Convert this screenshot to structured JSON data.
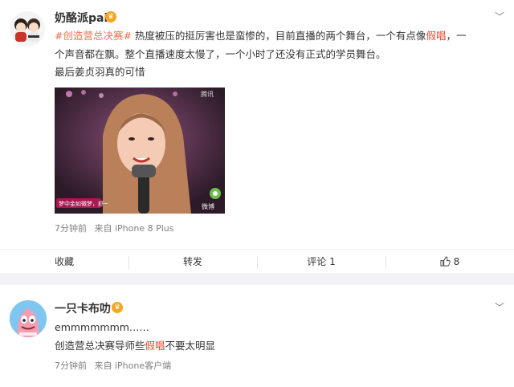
{
  "post": {
    "username": "奶酪派pai",
    "topic": "#创造营总决赛#",
    "line1_rest": " 热度被压的挺厉害也是蛮惨的，目前直播的两个舞台，一个有点像",
    "line1_highlight": "假唱",
    "line1_end": "，一",
    "line2": "个声音都在飘。整个直播速度太慢了，一个小时了还没有正式的学员舞台。",
    "line3": "最后姜贞羽真的可惜",
    "image_watermark_top": "腾讯",
    "image_watermark_bottom": "微博",
    "image_subtitle": "梦中金如微梦，舒~",
    "time": "7分钟前",
    "source": "来自 iPhone 8 Plus"
  },
  "actions": {
    "favorite": "收藏",
    "repost": "转发",
    "comment": "评论 1",
    "like_count": "8"
  },
  "comment": {
    "username": "一只卡布叻",
    "line1": "emmmmmmm……",
    "line2_before": "创造营总决赛导师些",
    "line2_highlight": "假唱",
    "line2_after": "不要太明显",
    "time": "7分钟前",
    "source": "来自 iPhone客户端"
  },
  "colors": {
    "topic": "#eb7350",
    "highlight": "#e5462d",
    "meta": "#808080"
  }
}
